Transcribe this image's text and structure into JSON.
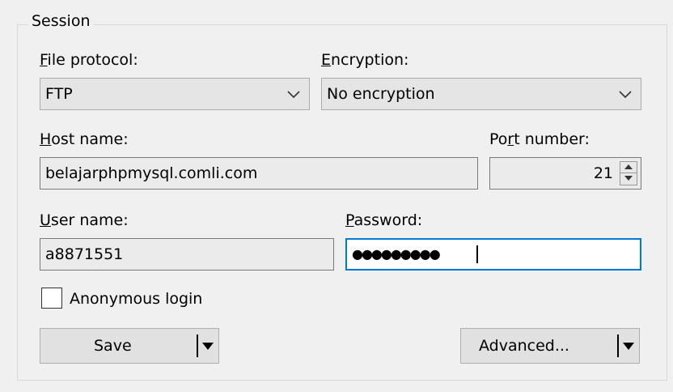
{
  "group_title": "Session",
  "file_protocol": {
    "label_mnemonic": "F",
    "label_rest": "ile protocol:",
    "value": "FTP"
  },
  "encryption": {
    "label_mnemonic": "E",
    "label_rest": "ncryption:",
    "value": "No encryption"
  },
  "host": {
    "label_mnemonic": "H",
    "label_rest": "ost name:",
    "value": "belajarphpmysql.comli.com"
  },
  "port": {
    "label_pre": "Po",
    "label_mnemonic": "r",
    "label_rest": "t number:",
    "value": "21"
  },
  "user": {
    "label_mnemonic": "U",
    "label_rest": "ser name:",
    "value": "a8871551"
  },
  "password": {
    "label_mnemonic": "P",
    "label_rest": "assword:",
    "value": "●●●●●●●●●"
  },
  "anonymous_login": {
    "label": "Anonymous login",
    "checked": false
  },
  "buttons": {
    "save": "Save",
    "advanced": "Advanced..."
  }
}
